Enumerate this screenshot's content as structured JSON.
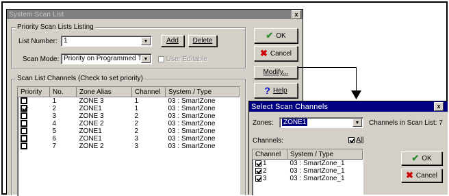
{
  "main_window": {
    "title": "System Scan List",
    "close_label": "x",
    "priority_group": {
      "legend": "Priority Scan Lists Listing",
      "list_number_label": "List Number:",
      "list_number_value": "1",
      "add_label": "Add",
      "delete_label": "Delete",
      "scan_mode_label": "Scan Mode:",
      "scan_mode_value": "Priority on Programmed TG",
      "user_editable_label": "User Editable"
    },
    "buttons": {
      "ok": "OK",
      "cancel": "Cancel",
      "modify": "Modify...",
      "help": "Help"
    },
    "channels_group": {
      "legend": "Scan List Channels (Check to set priority)",
      "columns": [
        "Priority",
        "No.",
        "Zone Alias",
        "Channel",
        "System / Type"
      ],
      "rows": [
        {
          "priority": false,
          "no": "1",
          "zone": "ZONE 3",
          "channel": "1",
          "system": "03 : SmartZone"
        },
        {
          "priority": true,
          "no": "2",
          "zone": "ZONE1",
          "channel": "1",
          "system": "03 : SmartZone"
        },
        {
          "priority": false,
          "no": "3",
          "zone": "ZONE 3",
          "channel": "2",
          "system": "03 : SmartZone"
        },
        {
          "priority": false,
          "no": "4",
          "zone": "ZONE 2",
          "channel": "2",
          "system": "03 : SmartZone"
        },
        {
          "priority": false,
          "no": "5",
          "zone": "ZONE1",
          "channel": "2",
          "system": "03 : SmartZone"
        },
        {
          "priority": false,
          "no": "6",
          "zone": "ZONE1",
          "channel": "3",
          "system": "03 : SmartZone"
        },
        {
          "priority": false,
          "no": "7",
          "zone": "ZONE 2",
          "channel": "3",
          "system": "03 : SmartZone"
        }
      ]
    }
  },
  "select_window": {
    "title": "Select Scan Channels",
    "close_label": "x",
    "zones_label": "Zones:",
    "zones_value": "ZONE1",
    "channels_in_scan_list": "Channels in Scan List: 7",
    "channels_label": "Channels:",
    "all_label": "All",
    "columns": [
      "Channel",
      "System / Type"
    ],
    "rows": [
      {
        "checked": true,
        "channel": "1",
        "system": "03 : SmartZone_1"
      },
      {
        "checked": true,
        "channel": "2",
        "system": "03 : SmartZone_1"
      },
      {
        "checked": true,
        "channel": "3",
        "system": "03 : SmartZone_1"
      }
    ],
    "ok": "OK",
    "cancel": "Cancel"
  },
  "colors": {
    "inactive_title": "#808080",
    "active_title": "#000080",
    "ok_check": "#2e8b2e",
    "cancel_x": "#cc0000",
    "help_q": "#0000cc",
    "selected_field": "#000080"
  }
}
